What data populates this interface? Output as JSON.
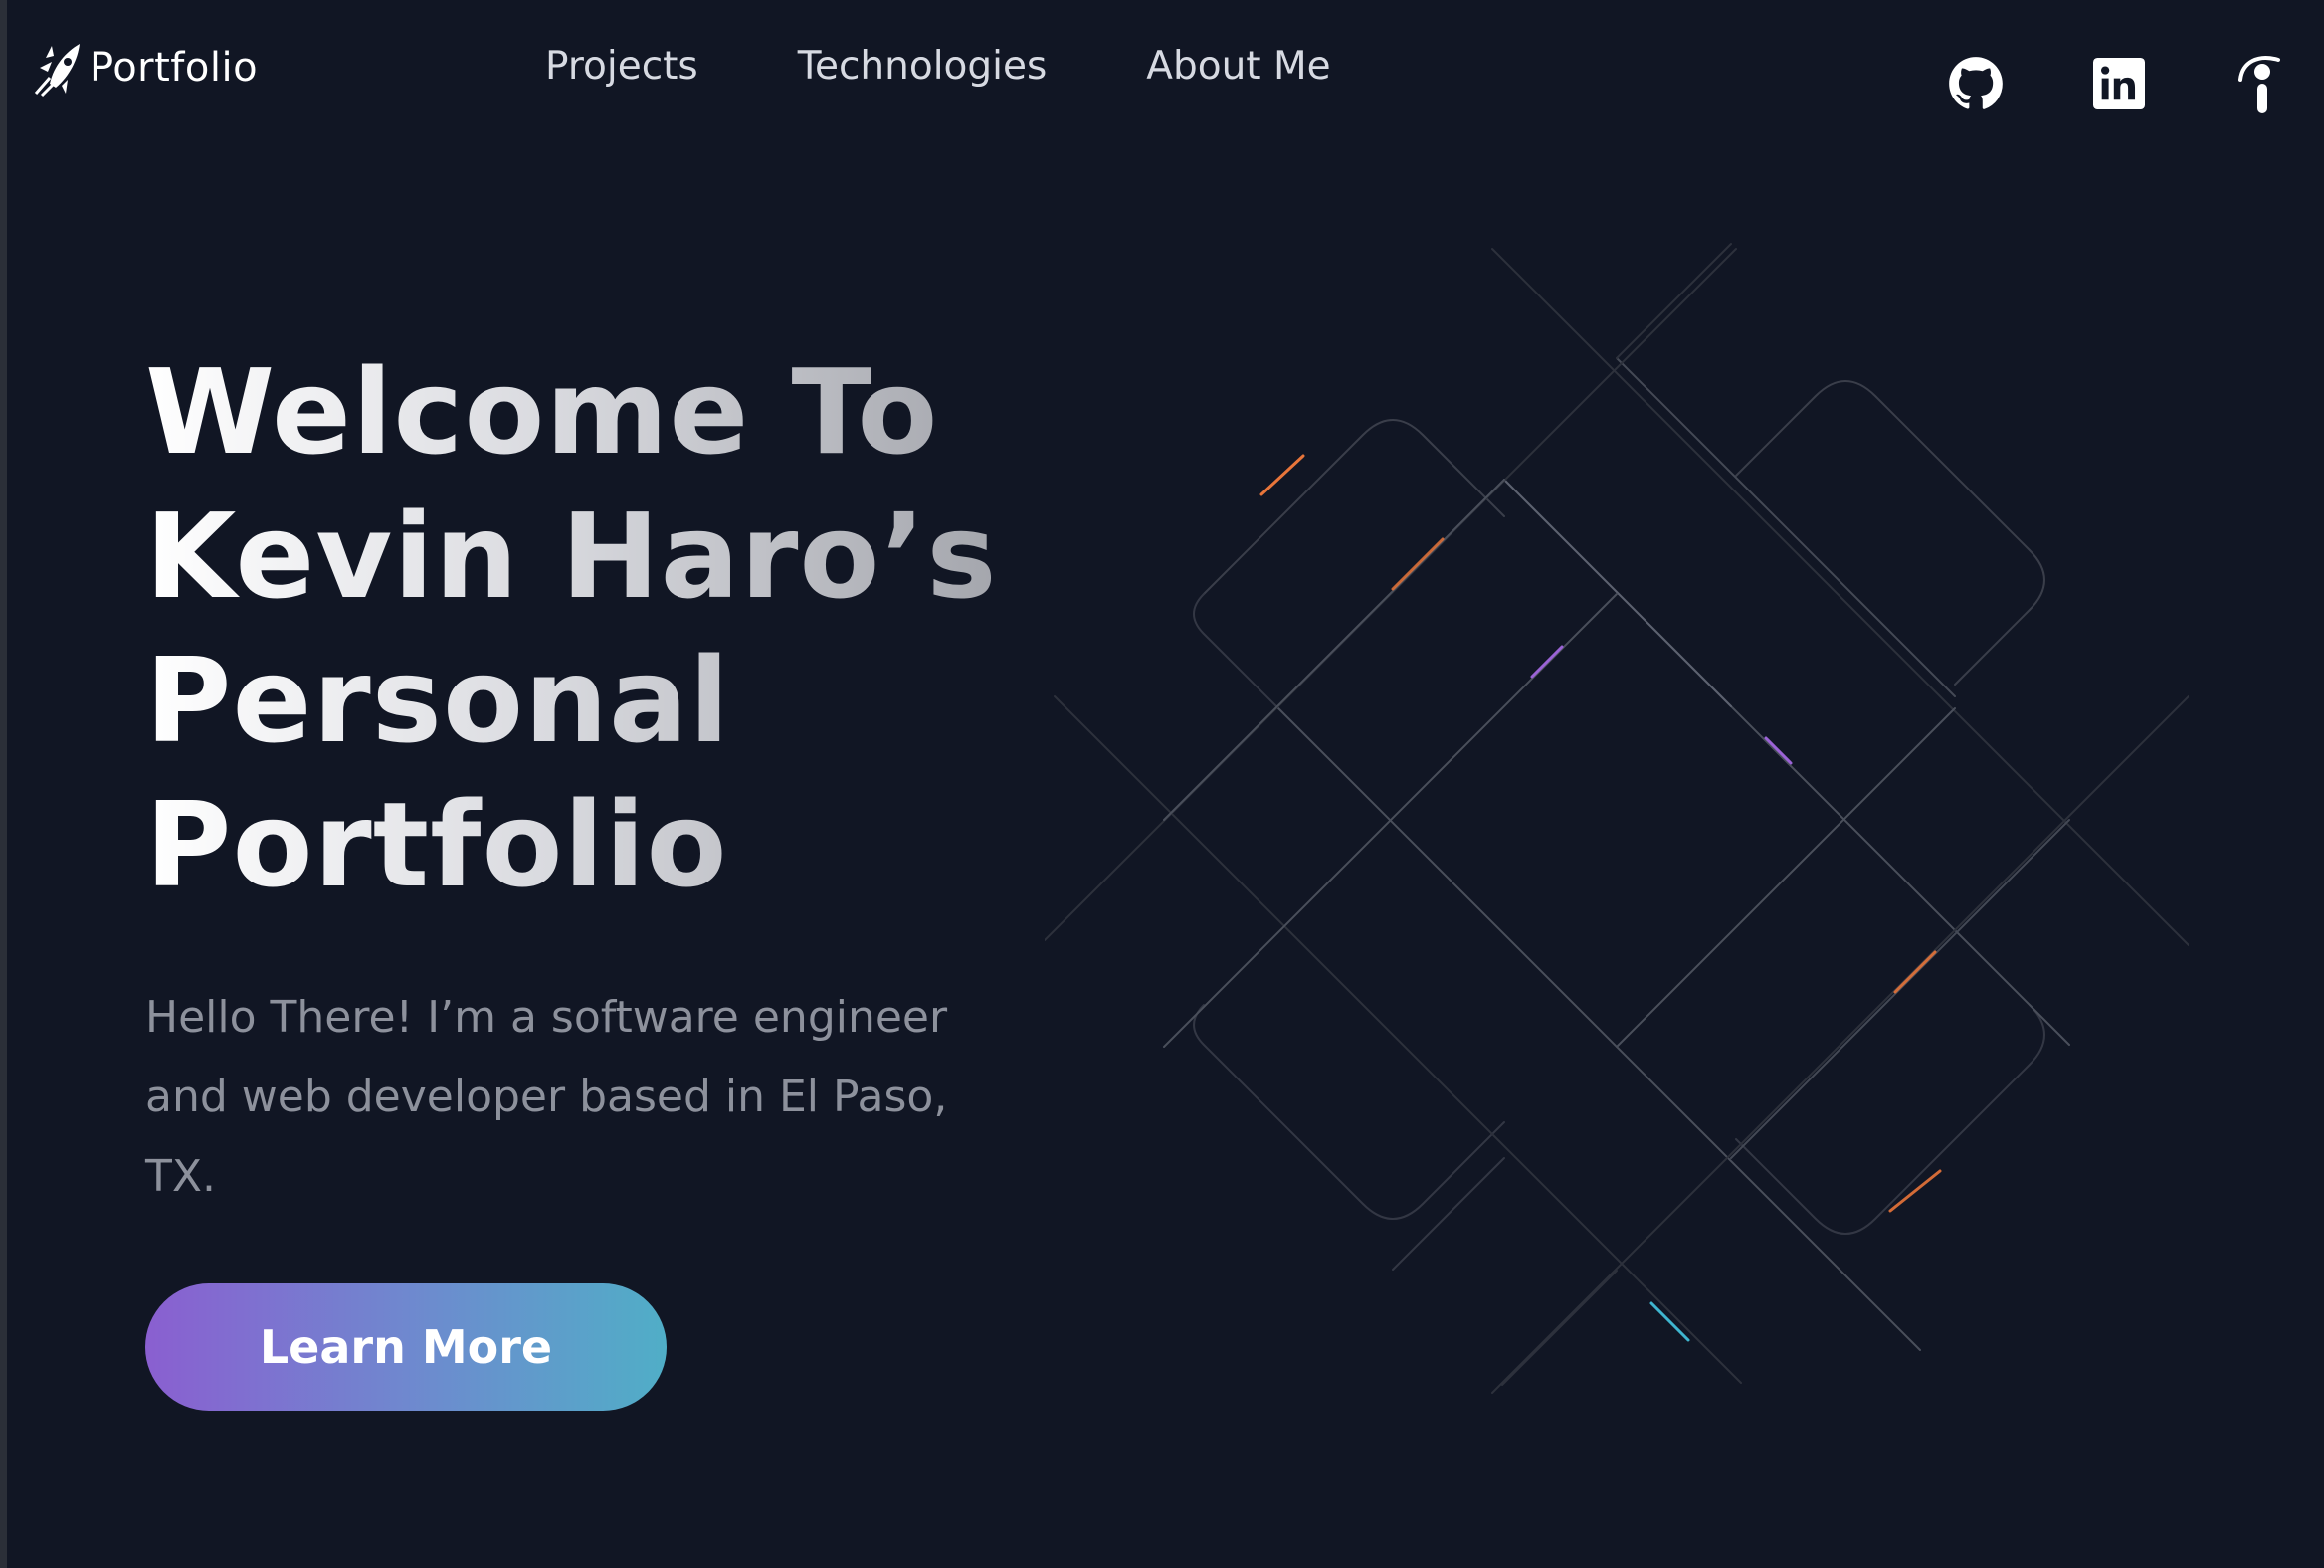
{
  "header": {
    "brand_name": "Portfolio",
    "nav": [
      {
        "label": "Projects"
      },
      {
        "label": "Technologies"
      },
      {
        "label": "About Me"
      }
    ],
    "social_icons": [
      "github-icon",
      "linkedin-icon",
      "info-icon"
    ]
  },
  "hero": {
    "title_lines": [
      "Welcome To",
      "Kevin Haro’s",
      "Personal",
      "Portfolio"
    ],
    "description": "Hello There! I’m a software engineer and web developer based in El Paso, TX.",
    "cta_label": "Learn More"
  },
  "colors": {
    "background": "#111624",
    "cta_gradient_start": "#8a5fd0",
    "cta_gradient_end": "#50aec7",
    "accent_orange": "#e8753a",
    "accent_purple": "#9b63d6",
    "accent_cyan": "#3fb5cf"
  }
}
